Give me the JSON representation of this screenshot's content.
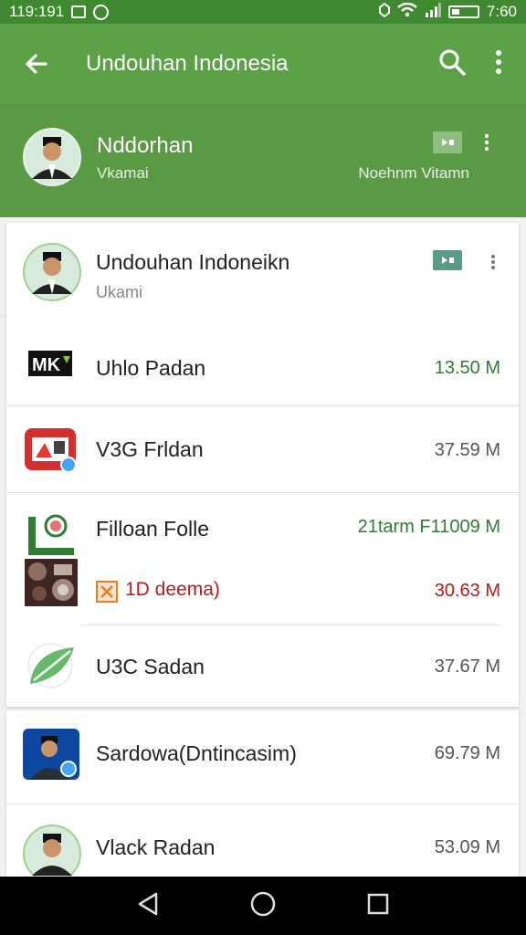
{
  "status_bar": {
    "time_left": "119:191",
    "time_right": "7:60"
  },
  "app_bar": {
    "title": "Undouhan Indonesia"
  },
  "header": {
    "name": "Nddorhan",
    "subtitle": "Vkamai",
    "right_text": "Noehnm Vitamn"
  },
  "card1": {
    "top_item": {
      "title": "Undouhan Indoneikn",
      "subtitle": "Ukami"
    },
    "items": [
      {
        "label": "Uhlo Padan",
        "size": "13.50 M",
        "size_color": "#2e7d32",
        "icon": "mk-logo-icon"
      },
      {
        "label": "V3G Frldan",
        "size": "37.59 M",
        "size_color": "#555555",
        "icon": "video-app-icon"
      },
      {
        "label": "Filloan Folle",
        "size": "21tarm F11009 M",
        "size_color": "#2e7d32",
        "icon": "l-logo-icon"
      },
      {
        "label": "1D deema)",
        "size": "30.63 M",
        "size_color": "#b71c1c",
        "icon": "food-thumbnail-icon"
      },
      {
        "label": "U3C Sadan",
        "size": "37.67 M",
        "size_color": "#555555",
        "icon": "leaf-app-icon"
      }
    ]
  },
  "card2": {
    "items": [
      {
        "label": "Sardowa(Dntincasim)",
        "size": "69.79 M"
      },
      {
        "label": "Vlack Radan",
        "size": "53.09 M"
      }
    ]
  },
  "colors": {
    "app_bar": "#5ca147",
    "status_bar": "#3f8a30",
    "accent_green": "#2e7d32",
    "accent_red": "#b71c1c"
  }
}
